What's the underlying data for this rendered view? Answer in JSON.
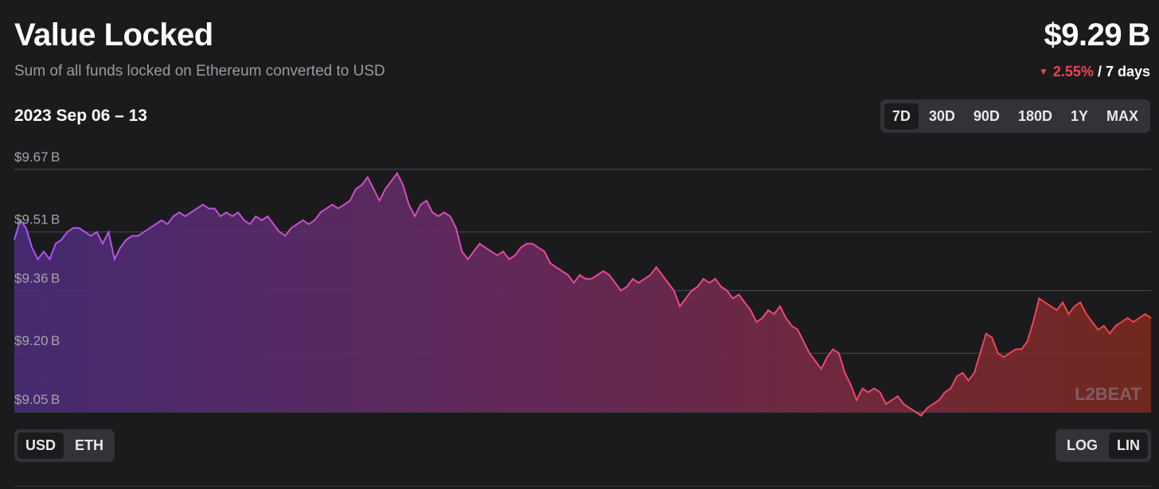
{
  "header": {
    "title": "Value Locked",
    "subtitle": "Sum of all funds locked on Ethereum converted to USD",
    "value": "$9.29 B",
    "change_pct": "2.55%",
    "change_period": "/ 7 days",
    "change_direction_icon": "triangle-down-icon"
  },
  "date_range": "2023 Sep 06 – 13",
  "range_buttons": [
    {
      "label": "7D",
      "active": true
    },
    {
      "label": "30D",
      "active": false
    },
    {
      "label": "90D",
      "active": false
    },
    {
      "label": "180D",
      "active": false
    },
    {
      "label": "1Y",
      "active": false
    },
    {
      "label": "MAX",
      "active": false
    }
  ],
  "currency_toggle": [
    {
      "label": "USD",
      "active": true
    },
    {
      "label": "ETH",
      "active": false
    }
  ],
  "scale_toggle": [
    {
      "label": "LOG",
      "active": false
    },
    {
      "label": "LIN",
      "active": true
    }
  ],
  "watermark": "L2BEAT",
  "colors": {
    "background": "#1b1b1d",
    "line_start": "#a855f7",
    "line_mid": "#ec4899",
    "line_end": "#ef4444",
    "negative": "#f0424e"
  },
  "chart_data": {
    "type": "area",
    "x_start": "2023-09-06",
    "x_end": "2023-09-13",
    "ylim": [
      9.05,
      9.67
    ],
    "yticks": [
      "$9.05 B",
      "$9.20 B",
      "$9.36 B",
      "$9.51 B",
      "$9.67 B"
    ],
    "grid": true,
    "series": [
      {
        "values": [
          9.49,
          9.54,
          9.52,
          9.47,
          9.44,
          9.46,
          9.44,
          9.48,
          9.49,
          9.51,
          9.52,
          9.52,
          9.51,
          9.5,
          9.51,
          9.48,
          9.51,
          9.44,
          9.47,
          9.49,
          9.5,
          9.5,
          9.51,
          9.52,
          9.53,
          9.54,
          9.53,
          9.55,
          9.56,
          9.55,
          9.56,
          9.57,
          9.58,
          9.57,
          9.57,
          9.55,
          9.56,
          9.55,
          9.56,
          9.54,
          9.53,
          9.55,
          9.54,
          9.55,
          9.53,
          9.51,
          9.5,
          9.52,
          9.53,
          9.54,
          9.53,
          9.54,
          9.56,
          9.57,
          9.58,
          9.57,
          9.58,
          9.59,
          9.62,
          9.63,
          9.65,
          9.62,
          9.59,
          9.62,
          9.64,
          9.66,
          9.63,
          9.58,
          9.55,
          9.58,
          9.59,
          9.56,
          9.55,
          9.56,
          9.55,
          9.52,
          9.46,
          9.44,
          9.46,
          9.48,
          9.47,
          9.46,
          9.45,
          9.46,
          9.44,
          9.45,
          9.47,
          9.48,
          9.48,
          9.47,
          9.46,
          9.43,
          9.42,
          9.41,
          9.4,
          9.38,
          9.4,
          9.39,
          9.39,
          9.4,
          9.41,
          9.4,
          9.38,
          9.36,
          9.37,
          9.39,
          9.38,
          9.39,
          9.4,
          9.42,
          9.4,
          9.38,
          9.36,
          9.32,
          9.34,
          9.36,
          9.37,
          9.39,
          9.38,
          9.39,
          9.37,
          9.36,
          9.34,
          9.35,
          9.33,
          9.31,
          9.28,
          9.29,
          9.31,
          9.3,
          9.32,
          9.29,
          9.27,
          9.26,
          9.23,
          9.2,
          9.18,
          9.16,
          9.19,
          9.21,
          9.2,
          9.15,
          9.12,
          9.08,
          9.11,
          9.1,
          9.11,
          9.1,
          9.07,
          9.08,
          9.09,
          9.07,
          9.06,
          9.05,
          9.04,
          9.06,
          9.07,
          9.08,
          9.1,
          9.11,
          9.14,
          9.15,
          9.13,
          9.15,
          9.2,
          9.25,
          9.24,
          9.2,
          9.19,
          9.2,
          9.21,
          9.21,
          9.23,
          9.28,
          9.34,
          9.33,
          9.32,
          9.31,
          9.33,
          9.3,
          9.32,
          9.33,
          9.3,
          9.28,
          9.26,
          9.27,
          9.25,
          9.27,
          9.28,
          9.29,
          9.28,
          9.29,
          9.3,
          9.29
        ]
      }
    ]
  }
}
